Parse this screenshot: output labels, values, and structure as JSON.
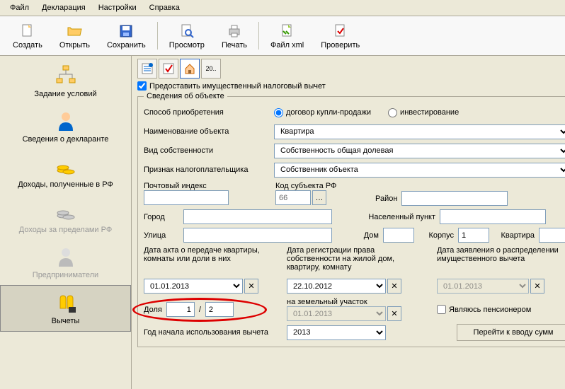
{
  "menu": {
    "file": "Файл",
    "declaration": "Декларация",
    "settings": "Настройки",
    "help": "Справка"
  },
  "toolbar": {
    "create": "Создать",
    "open": "Открыть",
    "save": "Сохранить",
    "preview": "Просмотр",
    "print": "Печать",
    "xml": "Файл xml",
    "check": "Проверить"
  },
  "sidebar": {
    "conditions": "Задание условий",
    "declarant": "Сведения о декларанте",
    "income_rf": "Доходы, полученные в РФ",
    "income_abroad": "Доходы за пределами РФ",
    "entrepreneurs": "Предприниматели",
    "deductions": "Вычеты"
  },
  "form": {
    "house_code": "20..",
    "provide_deduction": "Предоставить имущественный налоговый вычет",
    "provide_checked": true,
    "object_info": "Сведения об объекте",
    "acquisition_method": "Способ приобретения",
    "radio_contract": "договор купли-продажи",
    "radio_invest": "инвестирование",
    "radio_selected": "contract",
    "object_name": "Наименование объекта",
    "object_name_val": "Квартира",
    "ownership_type": "Вид собственности",
    "ownership_type_val": "Собственность общая долевая",
    "taxpayer_sign": "Признак налогоплательщика",
    "taxpayer_sign_val": "Собственник объекта",
    "postal": "Почтовый индекс",
    "postal_val": "",
    "subject_code": "Код субъекта РФ",
    "subject_code_val": "66",
    "district": "Район",
    "district_val": "",
    "city": "Город",
    "city_val": "",
    "settlement": "Населенный пункт",
    "settlement_val": "",
    "street": "Улица",
    "street_val": "",
    "house": "Дом",
    "house_val": "",
    "korpus": "Корпус",
    "korpus_val": "1",
    "flat": "Квартира",
    "flat_val": "",
    "date_act": "Дата акта о передаче квартиры, комнаты или доли в них",
    "date_act_val": "01.01.2013",
    "date_reg": "Дата регистрации права собственности на жилой дом, квартиру, комнату",
    "date_reg_val": "22.10.2012",
    "date_app": "Дата заявления о распределении имущественного вычета",
    "date_app_val": "01.01.2013",
    "land_plot": "на земельный участок",
    "land_plot_val": "01.01.2013",
    "share": "Доля",
    "share_num": "1",
    "share_den": "2",
    "pensioner": "Являюсь пенсионером",
    "year_start": "Год начала использования вычета",
    "year_start_val": "2013",
    "goto_sums": "Перейти к вводу сумм"
  }
}
